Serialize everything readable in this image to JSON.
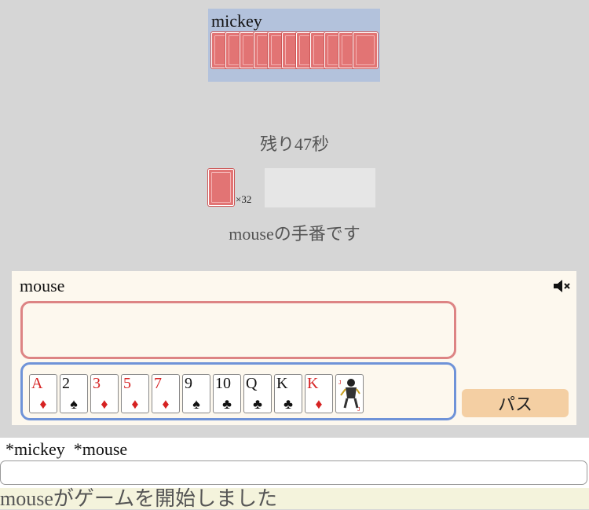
{
  "opponent": {
    "name": "mickey",
    "card_count": 11
  },
  "timer": "残り47秒",
  "deck": {
    "count": "×32"
  },
  "turn_message": "mouseの手番です",
  "player": {
    "name": "mouse",
    "mute_icon": "speaker-muted-icon"
  },
  "hand": [
    {
      "rank": "A",
      "suit": "♦",
      "color": "#d62222"
    },
    {
      "rank": "2",
      "suit": "♠",
      "color": "#111111"
    },
    {
      "rank": "3",
      "suit": "♦",
      "color": "#d62222"
    },
    {
      "rank": "5",
      "suit": "♦",
      "color": "#d62222"
    },
    {
      "rank": "7",
      "suit": "♦",
      "color": "#d62222"
    },
    {
      "rank": "9",
      "suit": "♠",
      "color": "#111111"
    },
    {
      "rank": "10",
      "suit": "♣",
      "color": "#111111"
    },
    {
      "rank": "Q",
      "suit": "♣",
      "color": "#111111"
    },
    {
      "rank": "K",
      "suit": "♣",
      "color": "#111111"
    },
    {
      "rank": "K",
      "suit": "♦",
      "color": "#d62222"
    },
    {
      "rank": "",
      "suit": "",
      "joker": true
    }
  ],
  "pass_label": "パス",
  "players_line": "*mickey  *mouse",
  "chat": {
    "value": "",
    "placeholder": ""
  },
  "log": "mouseがゲームを開始しました"
}
